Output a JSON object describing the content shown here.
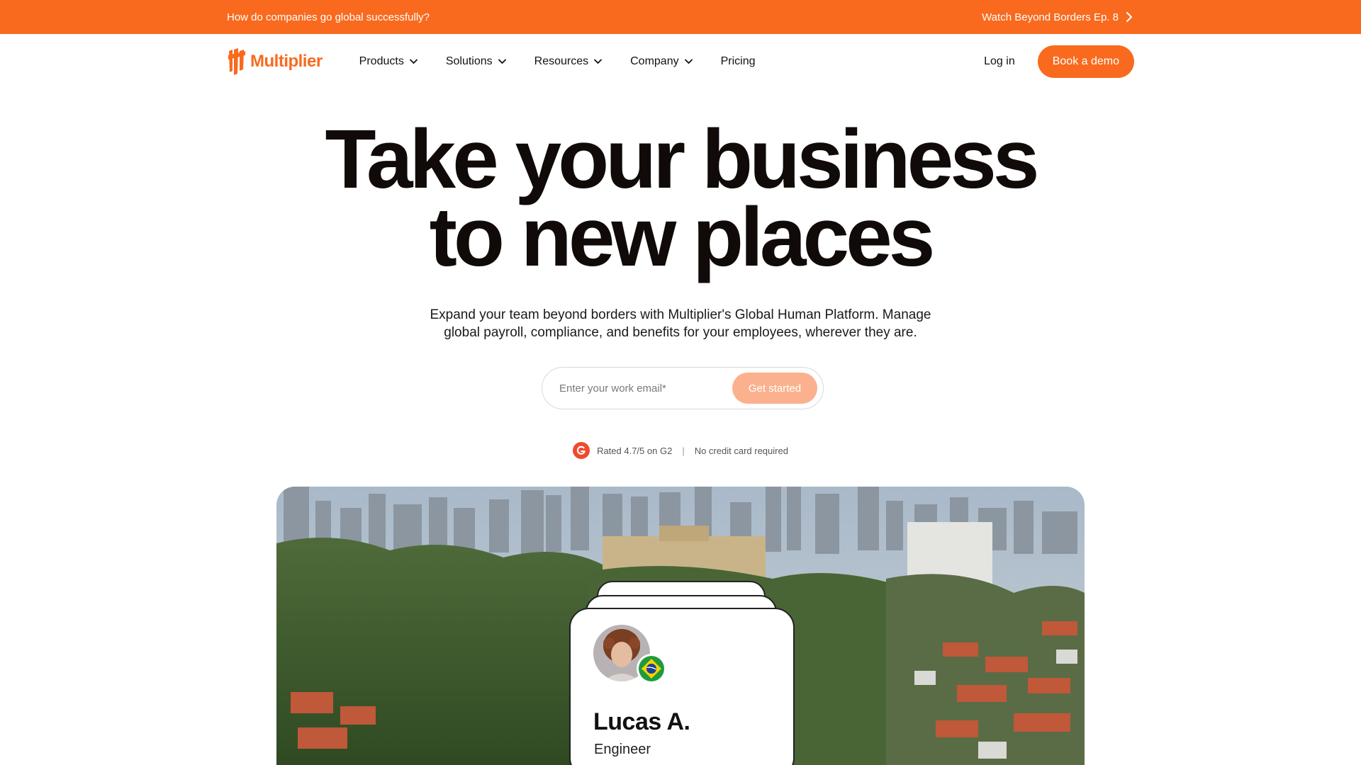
{
  "announcement": {
    "left_text": "How do companies go global successfully?",
    "right_link": "Watch Beyond Borders Ep. 8"
  },
  "nav": {
    "logo_text": "Multiplier",
    "menu": [
      {
        "label": "Products",
        "has_dropdown": true
      },
      {
        "label": "Solutions",
        "has_dropdown": true
      },
      {
        "label": "Resources",
        "has_dropdown": true
      },
      {
        "label": "Company",
        "has_dropdown": true
      },
      {
        "label": "Pricing",
        "has_dropdown": false
      }
    ],
    "login": "Log in",
    "demo_button": "Book a demo"
  },
  "hero": {
    "title_line1": "Take your business",
    "title_line2": "to new places",
    "subtitle_line1": "Expand your team beyond borders with Multiplier's Global Human Platform. Manage",
    "subtitle_line2": "global payroll, compliance, and benefits for your employees, wherever they are.",
    "email_placeholder": "Enter your work email*",
    "cta_button": "Get started",
    "rating_text": "Rated 4.7/5 on G2",
    "separator": "|",
    "no_card_text": "No credit card required"
  },
  "profile_card": {
    "name": "Lucas A.",
    "role": "Engineer",
    "flag": "brazil-flag"
  },
  "colors": {
    "brand_orange": "#f96a1e",
    "cta_disabled": "#fbb18e"
  }
}
